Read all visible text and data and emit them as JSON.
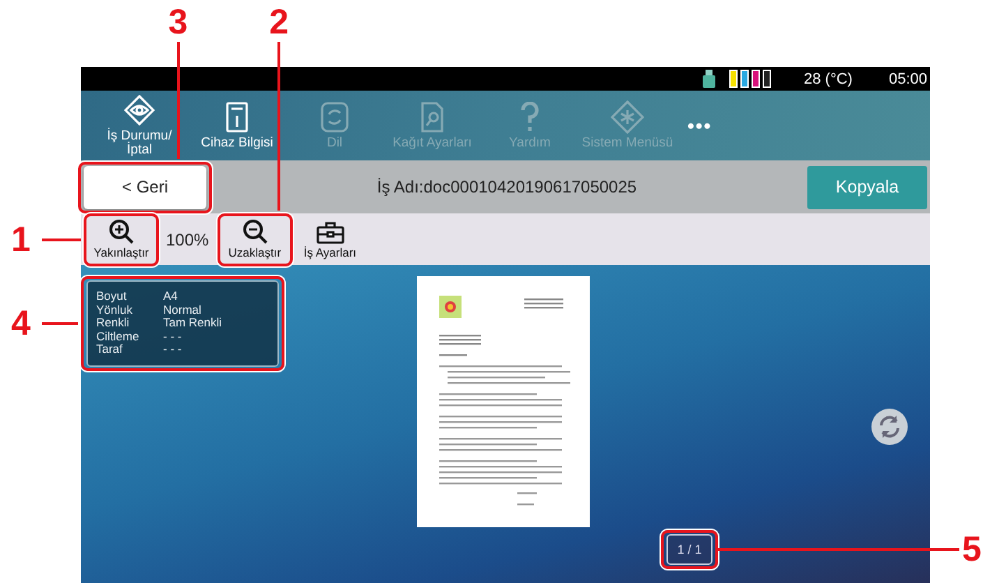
{
  "status_bar": {
    "temperature": "28 (°C)",
    "time": "05:00"
  },
  "menu": [
    {
      "kind": "status",
      "label": "İş Durumu/\nİptal",
      "disabled": false
    },
    {
      "kind": "info",
      "label": "Cihaz Bilgisi",
      "disabled": false
    },
    {
      "kind": "language",
      "label": "Dil",
      "disabled": true
    },
    {
      "kind": "paper",
      "label": "Kağıt Ayarları",
      "disabled": true
    },
    {
      "kind": "help",
      "label": "Yardım",
      "disabled": true
    },
    {
      "kind": "system",
      "label": "Sistem Menüsü",
      "disabled": true
    }
  ],
  "more_button": "•••",
  "title_bar": {
    "back_button": {
      "label": "< Geri",
      "callout": "3"
    },
    "job_name": "İş Adı:doc00010420190617050025",
    "copy_button": "Kopyala"
  },
  "toolbar": {
    "zoom_in": {
      "label": "Yakınlaştır",
      "callout": "1"
    },
    "zoom_level": "100%",
    "zoom_out": {
      "label": "Uzaklaştır",
      "callout": "2"
    },
    "job_settings": "İş Ayarları"
  },
  "info_panel_callout": "4",
  "info_panel": [
    {
      "label": "Boyut",
      "value": "A4"
    },
    {
      "label": "Yönluk",
      "value": "Normal"
    },
    {
      "label": "Renkli",
      "value": "Tam Renkli"
    },
    {
      "label": "Ciltleme",
      "value": "- - -"
    },
    {
      "label": "Taraf",
      "value": "- - -"
    }
  ],
  "page_counter": {
    "label": "1 / 1",
    "callout": "5"
  }
}
